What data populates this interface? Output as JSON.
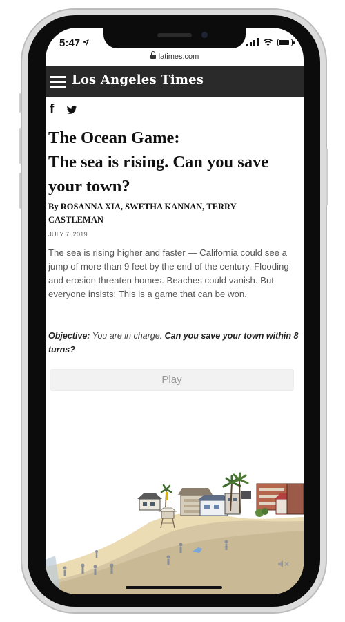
{
  "status_bar": {
    "time": "5:47"
  },
  "browser": {
    "url": "latimes.com"
  },
  "nav": {
    "masthead": "Los Angeles Times"
  },
  "article": {
    "headline_line1": "The Ocean Game:",
    "headline_line2": "The sea is rising. Can you save your town?",
    "byline": "By ROSANNA XIA, SWETHA KANNAN, TERRY CASTLEMAN",
    "date": "JULY 7, 2019",
    "body": "The sea is rising higher and faster — California could see a jump of more than 9 feet by the end of the century. Flooding and erosion threaten homes. Beaches could vanish. But everyone insists: This is a game that can be won.",
    "objective_label": "Objective:",
    "objective_text": " You are in charge. ",
    "objective_question": "Can you save your town within 8 turns?",
    "play_label": "Play"
  },
  "icons": [
    "location-arrow-icon",
    "signal-icon",
    "wifi-icon",
    "battery-icon",
    "lock-icon",
    "hamburger-icon",
    "facebook-icon",
    "twitter-icon",
    "mute-icon"
  ],
  "colors": {
    "navbar": "#2a2a2a",
    "sand": "#ecdcb4",
    "button": "#f2f2f2"
  }
}
